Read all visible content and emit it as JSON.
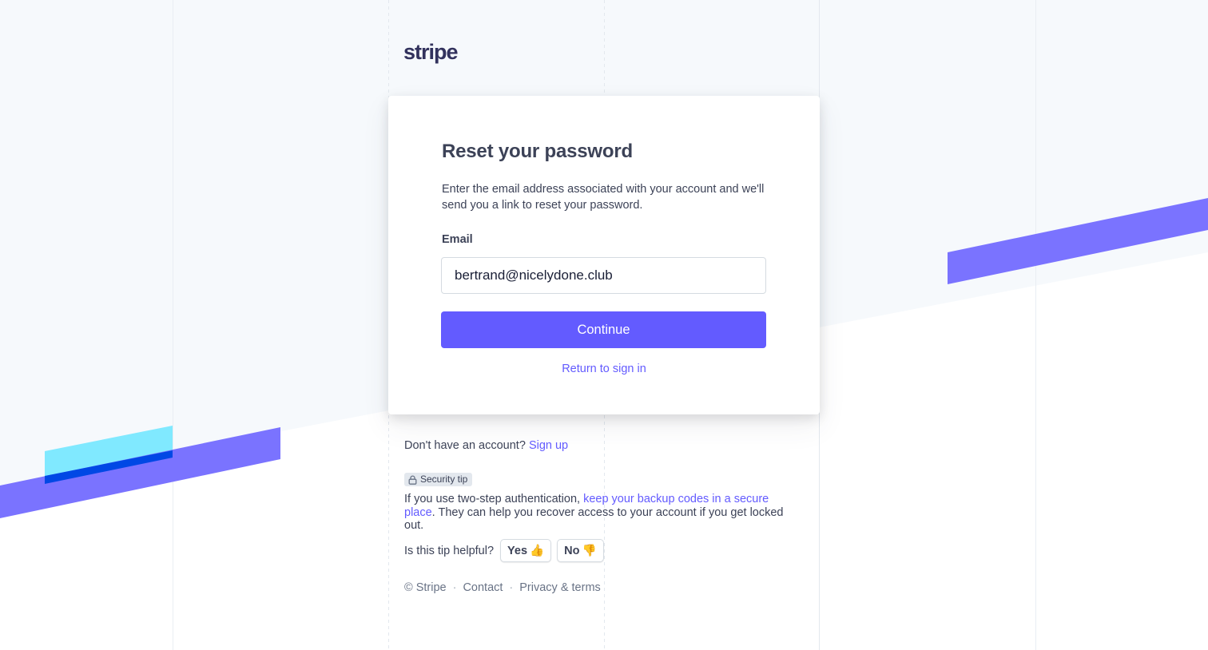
{
  "brand": {
    "logo_text": "stripe"
  },
  "card": {
    "title": "Reset your password",
    "description": "Enter the email address associated with your account and we'll send you a link to reset your password.",
    "email_label": "Email",
    "email_value": "bertrand@nicelydone.club",
    "continue_label": "Continue",
    "return_link": "Return to sign in"
  },
  "signup": {
    "prompt": "Don't have an account?",
    "link": "Sign up"
  },
  "security_tip": {
    "badge": "Security tip",
    "text_before": "If you use two-step authentication, ",
    "link": "keep your backup codes in a secure place",
    "text_after": ". They can help you recover access to your account if you get locked out.",
    "question": "Is this tip helpful?",
    "yes_label": "Yes",
    "yes_icon": "👍",
    "no_label": "No",
    "no_icon": "👎"
  },
  "footer": {
    "copyright": "© Stripe",
    "separator": "·",
    "contact": "Contact",
    "privacy": "Privacy & terms"
  },
  "colors": {
    "accent": "#635bff",
    "stripe_purple": "#7a73ff",
    "stripe_cyan": "#80e9ff",
    "stripe_blue": "#0048e5",
    "background_light": "#f6f9fc"
  }
}
